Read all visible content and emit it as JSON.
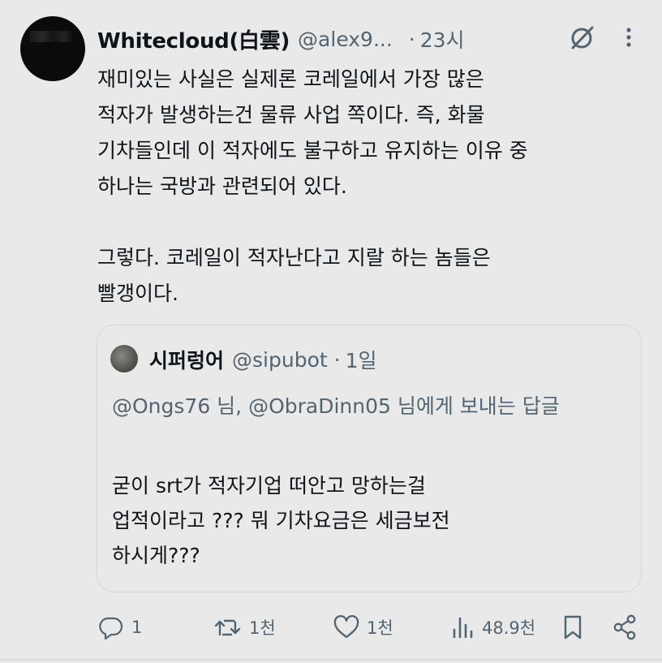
{
  "tweet": {
    "display_name": "Whitecloud(白雲)",
    "handle": "@alex9...",
    "separator": "·",
    "time": "23시",
    "text_lines_1": [
      "재미있는 사실은 실제론 코레일에서 가장 많은",
      "적자가 발생하는건 물류 사업 쪽이다. 즉, 화물",
      "기차들인데 이 적자에도 불구하고 유지하는 이유 중",
      "하나는 국방과 관련되어 있다."
    ],
    "text_lines_2": [
      "그렇다. 코레일이 적자난다고 지랄 하는 놈들은",
      "빨갱이다."
    ]
  },
  "quote": {
    "display_name": "시퍼렁어",
    "handle": "@sipubot",
    "separator": "·",
    "time": "1일",
    "reply_to": "@Ongs76 님, @ObraDinn05 님에게 보내는 답글",
    "text_lines": [
      "굳이 srt가 적자기업 떠안고 망하는걸",
      "업적이라고 ??? 뭐 기차요금은 세금보전",
      "하시게???"
    ]
  },
  "actions": {
    "reply_count": "1",
    "retweet_count": "1천",
    "like_count": "1천",
    "views_count": "48.9천"
  },
  "icons": {
    "grok": "grok-icon",
    "more": "more-vertical-icon",
    "reply": "reply-icon",
    "retweet": "retweet-icon",
    "like": "heart-icon",
    "views": "views-icon",
    "bookmark": "bookmark-icon",
    "share": "share-icon"
  },
  "colors": {
    "background": "#e9e9e9",
    "text": "#0f1419",
    "secondary": "#536471",
    "border": "#cfd9de"
  }
}
